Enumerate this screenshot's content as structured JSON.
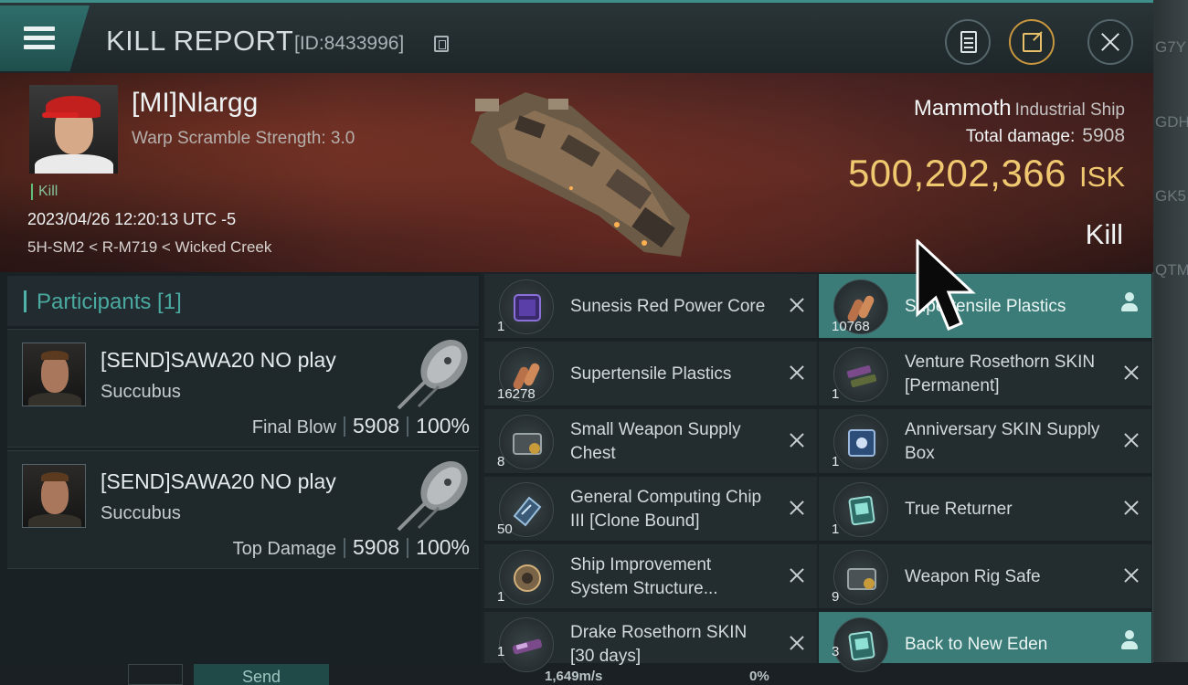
{
  "header": {
    "title": "KILL REPORT",
    "report_id": "[ID:8433996]"
  },
  "victim": {
    "name": "[MI]Nlargg",
    "warp_scramble": "Warp Scramble Strength: 3.0",
    "kill_tag": "Kill",
    "time": "2023/04/26 12:20:13 UTC -5",
    "location": "5H-SM2 < R-M719 < Wicked Creek"
  },
  "ship": {
    "name": "Mammoth",
    "class": "Industrial Ship",
    "total_damage_label": "Total damage:",
    "total_damage": "5908",
    "isk_value": "500,202,366",
    "isk_unit": "ISK",
    "status": "Kill"
  },
  "participants": {
    "title": "Participants [1]",
    "list": [
      {
        "name": "[SEND]SAWA20 NO play",
        "ship": "Succubus",
        "role": "Final Blow",
        "damage": "5908",
        "percent": "100%"
      },
      {
        "name": "[SEND]SAWA20 NO play",
        "ship": "Succubus",
        "role": "Top Damage",
        "damage": "5908",
        "percent": "100%"
      }
    ]
  },
  "items_left": [
    {
      "name": "Sunesis Red Power Core",
      "qty": "1",
      "icon": "power-core-icon"
    },
    {
      "name": "Supertensile Plastics",
      "qty": "16278",
      "icon": "plastics-icon"
    },
    {
      "name": "Small Weapon Supply Chest",
      "qty": "8",
      "icon": "supply-chest-icon"
    },
    {
      "name": "General Computing Chip III [Clone Bound]",
      "qty": "50",
      "icon": "chip-icon"
    },
    {
      "name": "Ship Improvement System Structure...",
      "qty": "1",
      "icon": "structure-icon"
    },
    {
      "name": "Drake Rosethorn SKIN [30 days]",
      "qty": "1",
      "icon": "skin-icon"
    }
  ],
  "items_right": [
    {
      "name": "Supertensile Plastics",
      "qty": "10768",
      "icon": "plastics-icon"
    },
    {
      "name": "Venture Rosethorn SKIN [Permanent]",
      "qty": "1",
      "icon": "skin-icon"
    },
    {
      "name": "Anniversary SKIN Supply Box",
      "qty": "1",
      "icon": "box-icon"
    },
    {
      "name": "True Returner",
      "qty": "1",
      "icon": "returner-icon"
    },
    {
      "name": "Weapon Rig Safe",
      "qty": "9",
      "icon": "safe-icon"
    },
    {
      "name": "Back to New Eden",
      "qty": "3",
      "icon": "returner-icon"
    }
  ],
  "background": {
    "codes": [
      "G7Y",
      "GDH",
      "GK5",
      "QTM"
    ],
    "send_label": "Send",
    "speed": "1,649m/s",
    "percent": "0%"
  },
  "colors": {
    "accent": "#3e8f8a",
    "isk": "#f0c870",
    "highlight_row": "#3b7c78"
  }
}
